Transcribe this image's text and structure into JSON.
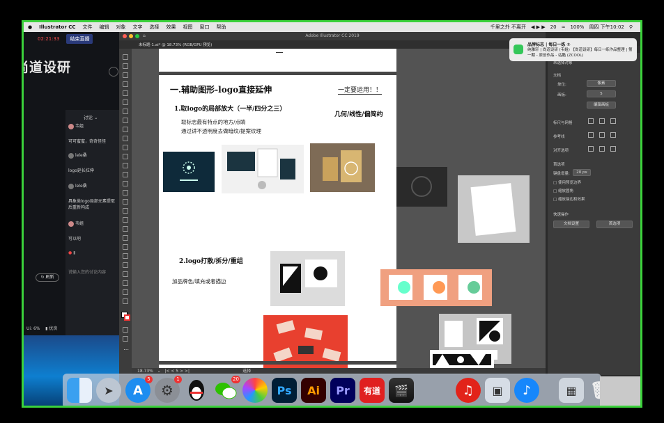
{
  "menubar": {
    "app": "Illustrator CC",
    "items": [
      "文件",
      "编辑",
      "对象",
      "文字",
      "选择",
      "效果",
      "视图",
      "窗口",
      "帮助"
    ],
    "center_text": "千里之外 不离开",
    "battery": "100%",
    "clock": "周四 下午10:02",
    "wechat_count": "20"
  },
  "live": {
    "timer": "02:21:33",
    "end_button": "结束直播",
    "watermark": "尚道设研",
    "chat_title": "讨论",
    "messages": [
      {
        "user": "韦姐",
        "text": "可可蜜蜜，奇奇怪怪"
      },
      {
        "user": "lele桑",
        "text": "logo延长拉伸"
      },
      {
        "user": "lele桑",
        "text": "具象类logo局部元素提取后重新构成"
      },
      {
        "user": "韦姐",
        "text": "可以吧"
      }
    ],
    "refresh_label": "刷新",
    "input_placeholder": "说输入您的讨论内容",
    "status_left": "Ui: 6%",
    "status_right": "优良"
  },
  "ai": {
    "window_title": "Adobe Illustrator CC 2019",
    "tab_label": "未标题-1.ai* @ 18.73% (RGB/GPU 预览)",
    "zoom": "18.73%",
    "page": "5",
    "status_tool": "选择",
    "artboard": {
      "section1_title": "一.辅助图形-logo直接延伸",
      "side_note": "一定要运用！！",
      "point1": "1.取logo的局部放大（一半/四分之三）",
      "point1_right": "几何/线性/偏简约",
      "point1_line1": "取标志最有特点的地方/点睛",
      "point1_line2": "通过讲不透明度去做暗纹/提案纹理",
      "point2": "2.logo打散/拆分/重组",
      "point2_line1": "加品牌色/填充或者描边"
    }
  },
  "properties": {
    "title": "未选择对象",
    "doc_label": "文档",
    "unit_label": "单位:",
    "unit_value": "像素",
    "artboard_label": "画板:",
    "artboard_value": "5",
    "edit_artboard": "编辑画板",
    "ruler_grid": "标尺与网格",
    "guides": "参考线",
    "align": "对齐选项",
    "prefs": "首选项",
    "key_increment_label": "键盘增量:",
    "key_increment_value": "20 px",
    "cb1": "使用预览边界",
    "cb2": "缩放圆角",
    "cb3": "缩放描边和效果",
    "quick_actions": "快速操作",
    "doc_setup": "文档设置",
    "prefs_btn": "首选项"
  },
  "notification": {
    "title": "品牌标志 | 每日一练 ②",
    "body": "纯雕轩 | 尚道设研 (韦姐) 【尚道设研】每日一练作品整理 | 第一期 - 原创作品 - 站酷 (ZCOOL)"
  },
  "dock": {
    "ai_label": "Ai",
    "ps_label": "Ps",
    "pr_label": "Pr",
    "youdao_label": "有道",
    "badge_appstore": "5",
    "badge_settings": "1",
    "badge_wechat": "20"
  }
}
